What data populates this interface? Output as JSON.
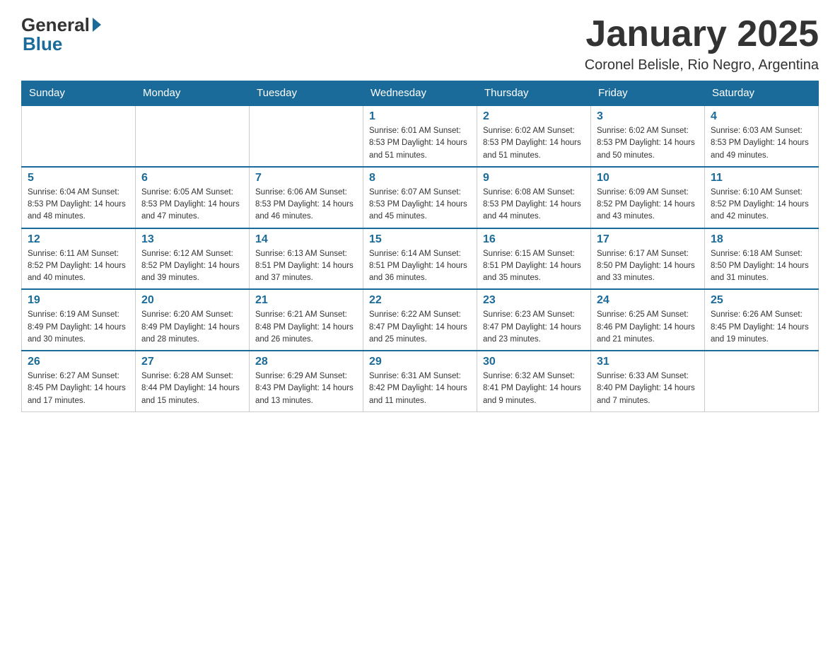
{
  "header": {
    "logo_general": "General",
    "logo_blue": "Blue",
    "month_title": "January 2025",
    "location": "Coronel Belisle, Rio Negro, Argentina"
  },
  "days_of_week": [
    "Sunday",
    "Monday",
    "Tuesday",
    "Wednesday",
    "Thursday",
    "Friday",
    "Saturday"
  ],
  "weeks": [
    [
      {
        "day": "",
        "info": ""
      },
      {
        "day": "",
        "info": ""
      },
      {
        "day": "",
        "info": ""
      },
      {
        "day": "1",
        "info": "Sunrise: 6:01 AM\nSunset: 8:53 PM\nDaylight: 14 hours and 51 minutes."
      },
      {
        "day": "2",
        "info": "Sunrise: 6:02 AM\nSunset: 8:53 PM\nDaylight: 14 hours and 51 minutes."
      },
      {
        "day": "3",
        "info": "Sunrise: 6:02 AM\nSunset: 8:53 PM\nDaylight: 14 hours and 50 minutes."
      },
      {
        "day": "4",
        "info": "Sunrise: 6:03 AM\nSunset: 8:53 PM\nDaylight: 14 hours and 49 minutes."
      }
    ],
    [
      {
        "day": "5",
        "info": "Sunrise: 6:04 AM\nSunset: 8:53 PM\nDaylight: 14 hours and 48 minutes."
      },
      {
        "day": "6",
        "info": "Sunrise: 6:05 AM\nSunset: 8:53 PM\nDaylight: 14 hours and 47 minutes."
      },
      {
        "day": "7",
        "info": "Sunrise: 6:06 AM\nSunset: 8:53 PM\nDaylight: 14 hours and 46 minutes."
      },
      {
        "day": "8",
        "info": "Sunrise: 6:07 AM\nSunset: 8:53 PM\nDaylight: 14 hours and 45 minutes."
      },
      {
        "day": "9",
        "info": "Sunrise: 6:08 AM\nSunset: 8:53 PM\nDaylight: 14 hours and 44 minutes."
      },
      {
        "day": "10",
        "info": "Sunrise: 6:09 AM\nSunset: 8:52 PM\nDaylight: 14 hours and 43 minutes."
      },
      {
        "day": "11",
        "info": "Sunrise: 6:10 AM\nSunset: 8:52 PM\nDaylight: 14 hours and 42 minutes."
      }
    ],
    [
      {
        "day": "12",
        "info": "Sunrise: 6:11 AM\nSunset: 8:52 PM\nDaylight: 14 hours and 40 minutes."
      },
      {
        "day": "13",
        "info": "Sunrise: 6:12 AM\nSunset: 8:52 PM\nDaylight: 14 hours and 39 minutes."
      },
      {
        "day": "14",
        "info": "Sunrise: 6:13 AM\nSunset: 8:51 PM\nDaylight: 14 hours and 37 minutes."
      },
      {
        "day": "15",
        "info": "Sunrise: 6:14 AM\nSunset: 8:51 PM\nDaylight: 14 hours and 36 minutes."
      },
      {
        "day": "16",
        "info": "Sunrise: 6:15 AM\nSunset: 8:51 PM\nDaylight: 14 hours and 35 minutes."
      },
      {
        "day": "17",
        "info": "Sunrise: 6:17 AM\nSunset: 8:50 PM\nDaylight: 14 hours and 33 minutes."
      },
      {
        "day": "18",
        "info": "Sunrise: 6:18 AM\nSunset: 8:50 PM\nDaylight: 14 hours and 31 minutes."
      }
    ],
    [
      {
        "day": "19",
        "info": "Sunrise: 6:19 AM\nSunset: 8:49 PM\nDaylight: 14 hours and 30 minutes."
      },
      {
        "day": "20",
        "info": "Sunrise: 6:20 AM\nSunset: 8:49 PM\nDaylight: 14 hours and 28 minutes."
      },
      {
        "day": "21",
        "info": "Sunrise: 6:21 AM\nSunset: 8:48 PM\nDaylight: 14 hours and 26 minutes."
      },
      {
        "day": "22",
        "info": "Sunrise: 6:22 AM\nSunset: 8:47 PM\nDaylight: 14 hours and 25 minutes."
      },
      {
        "day": "23",
        "info": "Sunrise: 6:23 AM\nSunset: 8:47 PM\nDaylight: 14 hours and 23 minutes."
      },
      {
        "day": "24",
        "info": "Sunrise: 6:25 AM\nSunset: 8:46 PM\nDaylight: 14 hours and 21 minutes."
      },
      {
        "day": "25",
        "info": "Sunrise: 6:26 AM\nSunset: 8:45 PM\nDaylight: 14 hours and 19 minutes."
      }
    ],
    [
      {
        "day": "26",
        "info": "Sunrise: 6:27 AM\nSunset: 8:45 PM\nDaylight: 14 hours and 17 minutes."
      },
      {
        "day": "27",
        "info": "Sunrise: 6:28 AM\nSunset: 8:44 PM\nDaylight: 14 hours and 15 minutes."
      },
      {
        "day": "28",
        "info": "Sunrise: 6:29 AM\nSunset: 8:43 PM\nDaylight: 14 hours and 13 minutes."
      },
      {
        "day": "29",
        "info": "Sunrise: 6:31 AM\nSunset: 8:42 PM\nDaylight: 14 hours and 11 minutes."
      },
      {
        "day": "30",
        "info": "Sunrise: 6:32 AM\nSunset: 8:41 PM\nDaylight: 14 hours and 9 minutes."
      },
      {
        "day": "31",
        "info": "Sunrise: 6:33 AM\nSunset: 8:40 PM\nDaylight: 14 hours and 7 minutes."
      },
      {
        "day": "",
        "info": ""
      }
    ]
  ]
}
